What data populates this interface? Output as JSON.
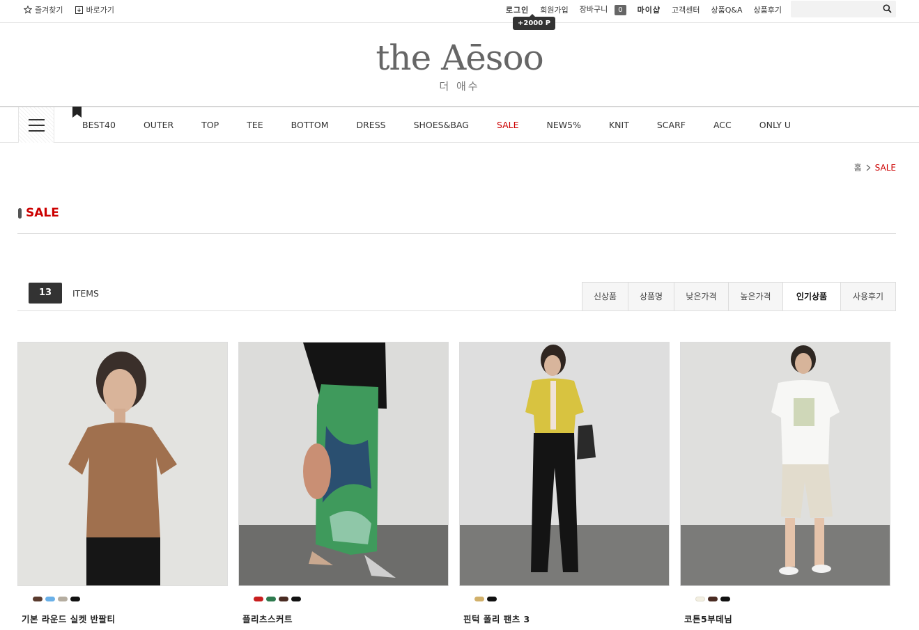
{
  "topbar": {
    "favorite": "즐겨찾기",
    "shortcut": "바로가기",
    "login": "로그인",
    "join": "회원가입",
    "cart": "장바구니",
    "cart_count": "0",
    "mypage": "마이샵",
    "service": "고객센터",
    "qa": "상품Q&A",
    "review": "상품후기",
    "point_tip": "+2000 P",
    "search_placeholder": ""
  },
  "logo": {
    "en": "the Aēsoo",
    "ko": "더 애수"
  },
  "nav": {
    "items": [
      "BEST40",
      "OUTER",
      "TOP",
      "TEE",
      "BOTTOM",
      "DRESS",
      "SHOES&BAG",
      "SALE",
      "NEW5%",
      "KNIT",
      "SCARF",
      "ACC",
      "ONLY U"
    ]
  },
  "breadcrumb": {
    "home": "홈",
    "current": "SALE"
  },
  "page": {
    "title": "SALE",
    "count": "13",
    "items_label": "ITEMS"
  },
  "sort": [
    "신상품",
    "상품명",
    "낮은가격",
    "높은가격",
    "인기상품",
    "사용후기"
  ],
  "sort_active": "인기상품",
  "products": [
    {
      "name": "기본 라운드 실켓 반팔티",
      "colors": [
        "#5a3b2e",
        "#6ab0e8",
        "#b5ada0",
        "#111111"
      ]
    },
    {
      "name": "플리츠스커트",
      "colors": [
        "#c81e1e",
        "#2e7a4e",
        "#4a2b22",
        "#111111"
      ]
    },
    {
      "name": "핀턱 폴리 팬츠 3",
      "colors": [
        "#d1b06a",
        "#111111"
      ]
    },
    {
      "name": "코튼5부데님",
      "colors": [
        "#f3efe2",
        "#4a2b22",
        "#111111"
      ]
    }
  ]
}
